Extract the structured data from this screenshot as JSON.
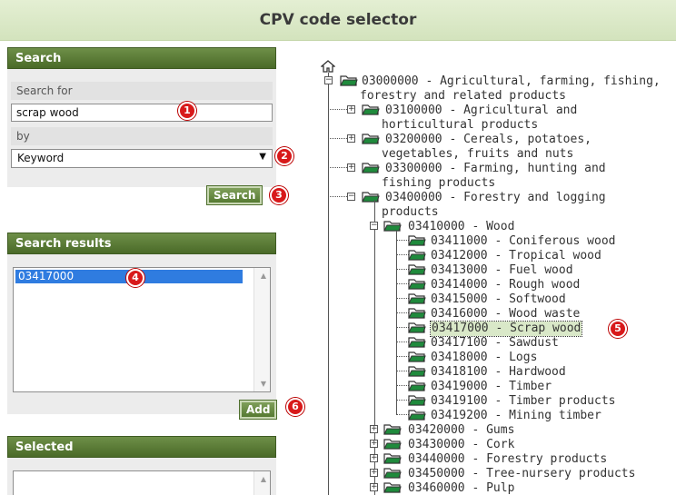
{
  "title": "CPV code selector",
  "search_panel": {
    "header": "Search",
    "search_for_label": "Search for",
    "search_value": "scrap wood",
    "by_label": "by",
    "by_value": "Keyword",
    "search_button": "Search"
  },
  "results_panel": {
    "header": "Search results",
    "items": [
      "03417000"
    ],
    "add_button": "Add"
  },
  "selected_panel": {
    "header": "Selected"
  },
  "badges": [
    "1",
    "2",
    "3",
    "4",
    "5",
    "6"
  ],
  "tree": {
    "root": {
      "line1": "03000000 - Agricultural, farming, fishing,",
      "line2": "forestry and related products"
    },
    "level1": [
      {
        "line1": "03100000 - Agricultural and",
        "line2": "horticultural products"
      },
      {
        "line1": "03200000 - Cereals, potatoes,",
        "line2": "vegetables, fruits and nuts"
      },
      {
        "line1": "03300000 - Farming, hunting and",
        "line2": "fishing products"
      },
      {
        "line1": "03400000 - Forestry and logging",
        "line2": "products"
      }
    ],
    "level2_wood": "03410000 - Wood",
    "wood_children": [
      "03411000 - Coniferous wood",
      "03412000 - Tropical wood",
      "03413000 - Fuel wood",
      "03414000 - Rough wood",
      "03415000 - Softwood",
      "03416000 - Wood waste",
      "03417000 - Scrap wood",
      "03417100 - Sawdust",
      "03418000 - Logs",
      "03418100 - Hardwood",
      "03419000 - Timber",
      "03419100 - Timber products",
      "03419200 - Mining timber"
    ],
    "level2_rest": [
      "03420000 - Gums",
      "03430000 - Cork",
      "03440000 - Forestry products",
      "03450000 - Tree-nursery products",
      "03460000 - Pulp"
    ]
  }
}
